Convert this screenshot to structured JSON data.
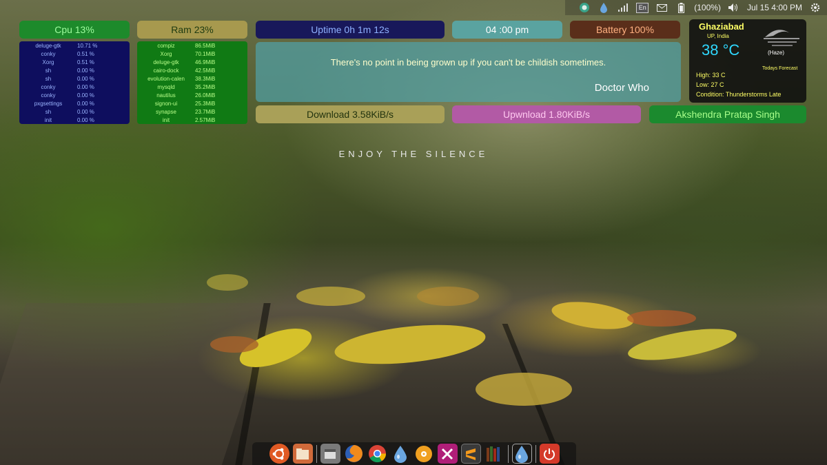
{
  "top_panel": {
    "language": "En",
    "battery_text": "(100%)",
    "datetime": "Jul 15  4:00 PM"
  },
  "conky": {
    "cpu_title": "Cpu 13%",
    "ram_title": "Ram 23%",
    "uptime": "Uptime 0h 1m 12s",
    "time": "04 :00  pm",
    "battery": "Battery 100%",
    "download": "Download  3.58KiB/s",
    "upload": "Upwnload  1.80KiB/s",
    "name": "Akshendra Pratap Singh",
    "cpu_processes": [
      {
        "name": "deluge-gtk",
        "value": "10.71 %"
      },
      {
        "name": "conky",
        "value": "0.51 %"
      },
      {
        "name": "Xorg",
        "value": "0.51 %"
      },
      {
        "name": "sh",
        "value": "0.00 %"
      },
      {
        "name": "sh",
        "value": "0.00 %"
      },
      {
        "name": "conky",
        "value": "0.00 %"
      },
      {
        "name": "conky",
        "value": "0.00 %"
      },
      {
        "name": "pxgsettings",
        "value": "0.00 %"
      },
      {
        "name": "sh",
        "value": "0.00 %"
      },
      {
        "name": "init",
        "value": "0.00 %"
      }
    ],
    "ram_processes": [
      {
        "name": "compiz",
        "value": "86.5MiB"
      },
      {
        "name": "Xorg",
        "value": "70.1MiB"
      },
      {
        "name": "deluge-gtk",
        "value": "46.9MiB"
      },
      {
        "name": "cairo-dock",
        "value": "42.5MiB"
      },
      {
        "name": "evolution-calen",
        "value": "38.3MiB"
      },
      {
        "name": "mysqld",
        "value": "35.2MiB"
      },
      {
        "name": "nautilus",
        "value": "26.0MiB"
      },
      {
        "name": "signon-ui",
        "value": "25.3MiB"
      },
      {
        "name": "synapse",
        "value": "23.7MiB"
      },
      {
        "name": "init",
        "value": "2.57MiB"
      }
    ],
    "quote": "There's no point in being grown up if you can't be childish sometimes.",
    "quote_author": "Doctor Who"
  },
  "weather": {
    "city": "Ghaziabad",
    "region": "UP, India",
    "temperature": "38 °C",
    "condition_short": "(Haze)",
    "forecast_label": "Todays Forecast",
    "high": "High:  33 C",
    "low": "Low:  27 C",
    "condition": "Condition:  Thunderstorms Late"
  },
  "wallpaper_text": "ENJOY THE SILENCE",
  "dock": {
    "icons": [
      "ubuntu-icon",
      "files-icon",
      "file-manager-icon",
      "firefox-icon",
      "chrome-icon",
      "deluge-icon",
      "cd-icon",
      "crossover-icon",
      "sublime-icon",
      "books-icon",
      "deluge-active-icon",
      "power-icon"
    ]
  },
  "colors": {
    "cpu": "#1d8a2b",
    "ram": "#a7994e",
    "uptime": "#18185a",
    "time": "#5aa3a0",
    "battery": "#5a2e1a",
    "upload": "#b25aa5",
    "weather_temp": "#2fd8ff"
  }
}
